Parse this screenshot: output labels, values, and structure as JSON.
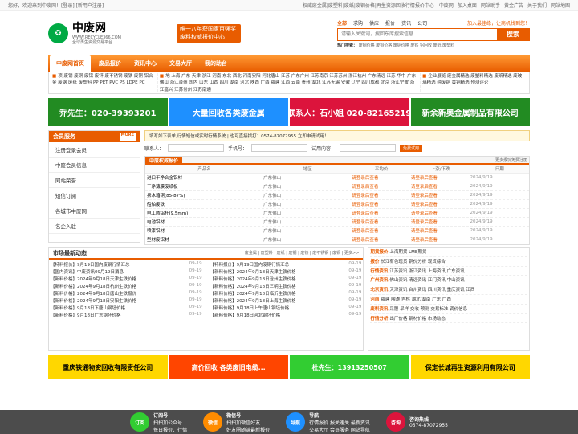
{
  "header": {
    "welcome": "您好，欢迎来到中废网！[登录] [新用户注册]",
    "links": [
      "权威废金属|废塑料|废纸|废钢价格|再生资源回收行情报价中心 - 中废网"
    ],
    "actions": [
      "加入桌面",
      "网站助手",
      "黄金广告",
      "关于我们",
      "网站地图"
    ],
    "logo": {
      "main": "中废网",
      "url": "WWW.RECYCLE366.COM",
      "sub": "全球再生资源交易平台"
    },
    "slogan": "唯一八年获国家百强奖 废料权威报价中心",
    "search": {
      "tabs": [
        "全部",
        "求购",
        "供应",
        "报价",
        "资讯",
        "公司"
      ],
      "placeholder": "请输入关键词，搜回东库搜索信息",
      "button": "搜索",
      "hot_label": "热门搜索：",
      "hot_terms": "废钢价格  废铜价格  废铝价格  废铁  铝回收  废纸  废塑料"
    },
    "ad_link": "加入最佳缘，让商机找到您！"
  },
  "nav": [
    {
      "label": "中废网首页",
      "active": true
    },
    {
      "label": "废品报价",
      "active": false
    },
    {
      "label": "资讯中心",
      "active": false
    },
    {
      "label": "交易大厅",
      "active": false
    },
    {
      "label": "我的助台",
      "active": false
    }
  ],
  "categories": {
    "col1": "项 废钢 废铜 废铝 废锌 废不锈钢 废铁 废铜 铝合金 废钢 废纸 废塑料 PP PET PVC PS LDPE PC",
    "col2": "地 上海 广东 天津 浙江 河南 东北 西北 河南安阳 河北唐山 江苏 广东广州 江苏南京 江苏苏州 浙江杭州 广东清远 江苏 华中 广东佛山 浙江台州 国内 山东 山西 四川 湖南 河北 陕西 广西 福建 江西 云南 贵州 湖北 江苏无锡 安徽 辽宁 四川成都 北京 浙江宁波 浙江嘉兴 江苏常州 江苏南通",
    "col3": "企业展览 废金属精选 废塑料精选 废纸精选 废玻璃精选 纯废铜 黄铜精选 预测评论"
  },
  "banners_top": [
    {
      "text": "乔先生：020-39393201",
      "color": "#228b22"
    },
    {
      "text": "大量回收各类废金属",
      "color": "#1e90ff"
    },
    {
      "text": "联系人：石小姐 020-82165219",
      "color": "#dc143c"
    },
    {
      "text": "新余新奥金属制品有限公司",
      "color": "#228b22"
    }
  ],
  "sidebar": {
    "title": "会员服务",
    "more": "MORE",
    "items": [
      "注册登录会员",
      "中废会员信息",
      "网站荣誉",
      "短信订阅",
      "各城市中废网",
      "名企入驻"
    ]
  },
  "center": {
    "notice": "填写如下表单,行情短信或实时行情系统 | 也可直接拨打：0574-87072955 立即申请试用！",
    "form": {
      "name": "联系人：",
      "phone": "手机号：",
      "code": "试用内容：",
      "btn": "免费试用"
    },
    "table": {
      "tab": "中废权威报价",
      "more": "更多报价免费注册",
      "headers": [
        "产品名",
        "地区",
        "平均价",
        "上涨/下跌",
        "日期"
      ],
      "rows": [
        [
          "进口干净合金铝材",
          "广东佛山",
          "请登录后查看",
          "请登录后查看",
          "2024/9/19"
        ],
        [
          "干净薄膜废纸板",
          "广东佛山",
          "请登录后查看",
          "请登录后查看",
          "2024/9/19"
        ],
        [
          "拆水箱铜(85-87%)",
          "广东佛山",
          "请登录后查看",
          "请登录后查看",
          "2024/9/19"
        ],
        [
          "船舶废铁",
          "广东佛山",
          "请登录后查看",
          "请登录后查看",
          "2024/9/19"
        ],
        [
          "电工圆铝杆(9.5mm)",
          "广东佛山",
          "请登录后查看",
          "请登录后查看",
          "2024/9/19"
        ],
        [
          "电池铝材",
          "广东佛山",
          "请登录后查看",
          "请登录后查看",
          "2024/9/19"
        ],
        [
          "喷漆铝材",
          "广东佛山",
          "请登录后查看",
          "请登录后查看",
          "2024/9/19"
        ],
        [
          "型材废铝材",
          "广东佛山",
          "请登录后查看",
          "请登录后查看",
          "2024/9/19"
        ]
      ]
    }
  },
  "news": {
    "title": "市场最新动态",
    "tags": "废金属 | 废塑料 | 废纸 | 废钢 | 废铁 | 废不锈钢 | 废铜 | 更多>>",
    "items": [
      [
        "【特料报价】9月19日国内废钢行情汇总",
        "09-19"
      ],
      [
        "【特料报价】9月19日国内废铜行情汇总",
        "09-19"
      ],
      [
        "【国内资讯】中废资讯09月19日消息",
        "09-19"
      ],
      [
        "【新料价格】2024年9月18日天津生铁价格",
        "09-19"
      ],
      [
        "【新料价格】2024年9月18日天津生铁价格",
        "09-19"
      ],
      [
        "【新料价格】2024年9月18日沧州生铁价格",
        "09-19"
      ],
      [
        "【新料价格】2024年9月18日杭州生铁价格",
        "09-19"
      ],
      [
        "【新料价格】2024年9月18日三明生铁价格",
        "09-19"
      ],
      [
        "【新料价格】2024年9月18日唐山生铁报价",
        "09-19"
      ],
      [
        "【新料价格】2024年9月18日临沂生铁价格",
        "09-19"
      ],
      [
        "【新料价格】2024年9月18日安阳生铁价格",
        "09-19"
      ],
      [
        "【新料价格】2024年9月18日上海生铁价格",
        "09-19"
      ],
      [
        "【新料价格】9月18日下唐山钢坯价格",
        "09-19"
      ],
      [
        "【新料价格】9月18日上午唐山钢坯价格",
        "09-19"
      ],
      [
        "【新料价格】9月18日广东钢坯价格",
        "09-19"
      ],
      [
        "【新料价格】9月18日河北钢坯价格",
        "09-19"
      ]
    ]
  },
  "side_info": [
    {
      "label": "期货报价",
      "content": "上海期货 LME期货"
    },
    {
      "label": "报价",
      "content": "长江有色现货 铜价分析 现货综合"
    },
    {
      "label": "行情资讯",
      "content": "江苏资讯 浙江资讯 上海资讯 广东资讯"
    },
    {
      "label": "广州资讯",
      "content": "佛山资讯 清远资讯 江门资讯 中山资讯"
    },
    {
      "label": "北京资讯",
      "content": "天津资讯 台州资讯 四川资讯 重庆资讯 江西"
    },
    {
      "label": "河南",
      "content": "福建 陶滩 吉林 湖北 湖南 广东 广西"
    },
    {
      "label": "废料资讯",
      "content": "采腰 旱样 交收 预测 交易标准 调价信息"
    },
    {
      "label": "行情分析",
      "content": "出厂价格 钢材价格 市场动态"
    }
  ],
  "banners_bottom": [
    {
      "text": "重庆铁通物资回收有限责任公司",
      "color": "#ffd700"
    },
    {
      "text": "高价回收 各类废旧电缆...",
      "color": "#ff4500"
    },
    {
      "text": "杜先生：13913250507",
      "color": "#32cd32"
    },
    {
      "text": "保定长城再生资源利用有限公司",
      "color": "#ffd700"
    }
  ],
  "footer": [
    {
      "label": "订阅号",
      "sub": "扫扫加公众号\n每日报价、行情",
      "color": "#32cd32"
    },
    {
      "label": "微信号",
      "sub": "扫扫加微信好友\n好友圈随端最新报价",
      "color": "#ff8c00"
    },
    {
      "label": "导航",
      "sub": "行情报价  报关速关  最新资讯\n交易大厅  会员服务  网站导航",
      "color": "#1e90ff"
    },
    {
      "label": "咨询热线",
      "sub": "0574-87072955",
      "color": "#dc143c"
    }
  ]
}
